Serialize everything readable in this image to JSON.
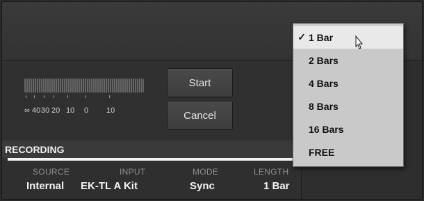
{
  "buttons": {
    "start": "Start",
    "cancel": "Cancel"
  },
  "meter": {
    "scale": [
      "∞",
      "40",
      "30",
      "20",
      "10",
      "0",
      "10"
    ]
  },
  "recording": {
    "title": "RECORDING",
    "fields": [
      {
        "label": "SOURCE",
        "value": "Internal"
      },
      {
        "label": "INPUT",
        "value": "EK-TL A Kit"
      },
      {
        "label": "MODE",
        "value": "Sync"
      },
      {
        "label": "LENGTH",
        "value": "1 Bar"
      }
    ]
  },
  "length_menu": {
    "selected_check": "✓",
    "items": [
      "1 Bar",
      "2 Bars",
      "4 Bars",
      "8 Bars",
      "16 Bars",
      "FREE"
    ],
    "selected_index": 0
  },
  "colors": {
    "background": "#303030",
    "menu_background": "#c9c9c9",
    "menu_selected": "#e9e9e9",
    "recording_underline": "#f5f5f5"
  },
  "icons": [
    "checkmark-icon",
    "pointer-cursor-icon"
  ]
}
